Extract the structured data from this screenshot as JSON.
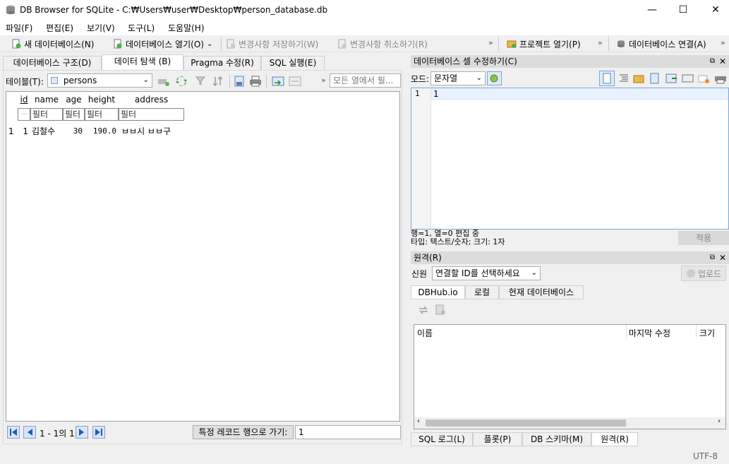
{
  "window": {
    "title": "DB Browser for SQLite - C:₩Users₩user₩Desktop₩person_database.db",
    "minimize": "—",
    "maximize": "☐",
    "close": "✕"
  },
  "menu": [
    "파일(F)",
    "편집(E)",
    "보기(V)",
    "도구(L)",
    "도움말(H)"
  ],
  "toolbar": {
    "new_db": "새 데이터베이스(N)",
    "open_db": "데이터베이스 열기(O)",
    "write_changes": "변경사항 저장하기(W)",
    "revert_changes": "변경사항 취소하기(R)",
    "open_project": "프로젝트 열기(P)",
    "attach_db": "데이터베이스 연결(A)",
    "more": "»"
  },
  "left_tabs": [
    "데이터베이스 구조(D)",
    "데이터 탐색 (B)",
    "Pragma 수정(R)",
    "SQL 실행(E)"
  ],
  "browse": {
    "table_label": "테이블(T):",
    "table_value": "persons",
    "filter_all_placeholder": "모든 열에서 필...",
    "columns": [
      "id",
      "name",
      "age",
      "height",
      "address"
    ],
    "filter_placeholder": "필터",
    "rows": [
      {
        "rownum": "1",
        "id": "1",
        "name": "김철수",
        "age": "30",
        "height": "190.0",
        "address": "ㅂㅂ시 ㅂㅂ구"
      }
    ],
    "page_info": "1 - 1의 1",
    "goto_button": "특정 레코드 행으로 가기:",
    "goto_value": "1"
  },
  "edit_cell": {
    "title": "데이터베이스 셀 수정하기(C)",
    "mode_label": "모드:",
    "mode_value": "문자열",
    "line_number": "1",
    "content": "1",
    "status_line1": "행=1, 열=0 편집 중",
    "status_line2": "타입: 텍스트/숫자; 크기: 1자",
    "apply_button": "적용"
  },
  "remote": {
    "title": "원격(R)",
    "identity_label": "신원",
    "identity_value": "연결할 ID를 선택하세요",
    "upload_button": "업로드",
    "tabs": [
      "DBHub.io",
      "로컬",
      "현재 데이터베이스"
    ],
    "columns": [
      "이름",
      "마지막 수정",
      "크기"
    ]
  },
  "bottom_tabs": [
    "SQL 로그(L)",
    "플롯(P)",
    "DB 스키마(M)",
    "원격(R)"
  ],
  "statusbar": {
    "encoding": "UTF-8"
  },
  "colors": {
    "accent": "#3c7fb1",
    "selected_row_highlight": "#e8f2fe",
    "nav_button": "#d8e4f8"
  }
}
